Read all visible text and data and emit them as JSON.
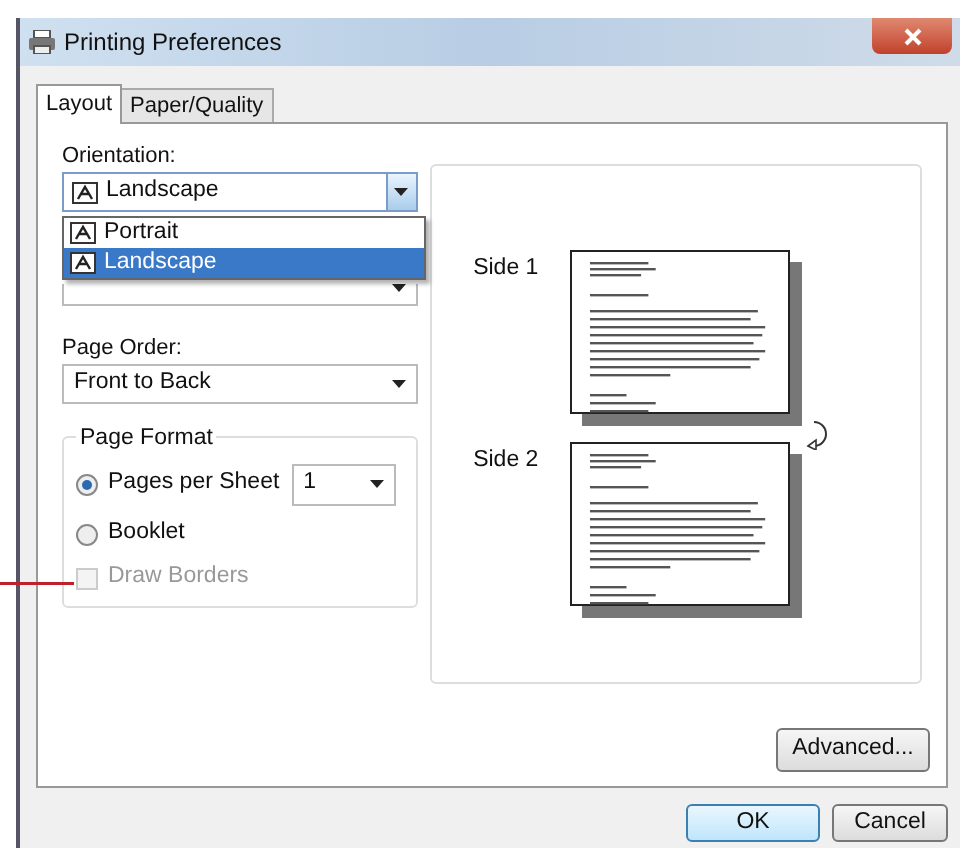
{
  "window": {
    "title": "Printing Preferences"
  },
  "tabs": [
    {
      "label": "Layout",
      "selected": true
    },
    {
      "label": "Paper/Quality",
      "selected": false
    }
  ],
  "orientation": {
    "label": "Orientation:",
    "value": "Landscape",
    "options": [
      {
        "label": "Portrait",
        "selected": false
      },
      {
        "label": "Landscape",
        "selected": true
      }
    ]
  },
  "page_order": {
    "label": "Page Order:",
    "value": "Front to Back"
  },
  "page_format": {
    "title": "Page Format",
    "pages_per_sheet": {
      "label": "Pages per Sheet",
      "selected": true,
      "value": "1"
    },
    "booklet": {
      "label": "Booklet",
      "selected": false
    },
    "draw_borders": {
      "label": "Draw Borders",
      "checked": false,
      "disabled": true
    }
  },
  "preview": {
    "sides": [
      {
        "label": "Side 1"
      },
      {
        "label": "Side 2"
      }
    ]
  },
  "buttons": {
    "advanced": "Advanced...",
    "ok": "OK",
    "cancel": "Cancel"
  }
}
